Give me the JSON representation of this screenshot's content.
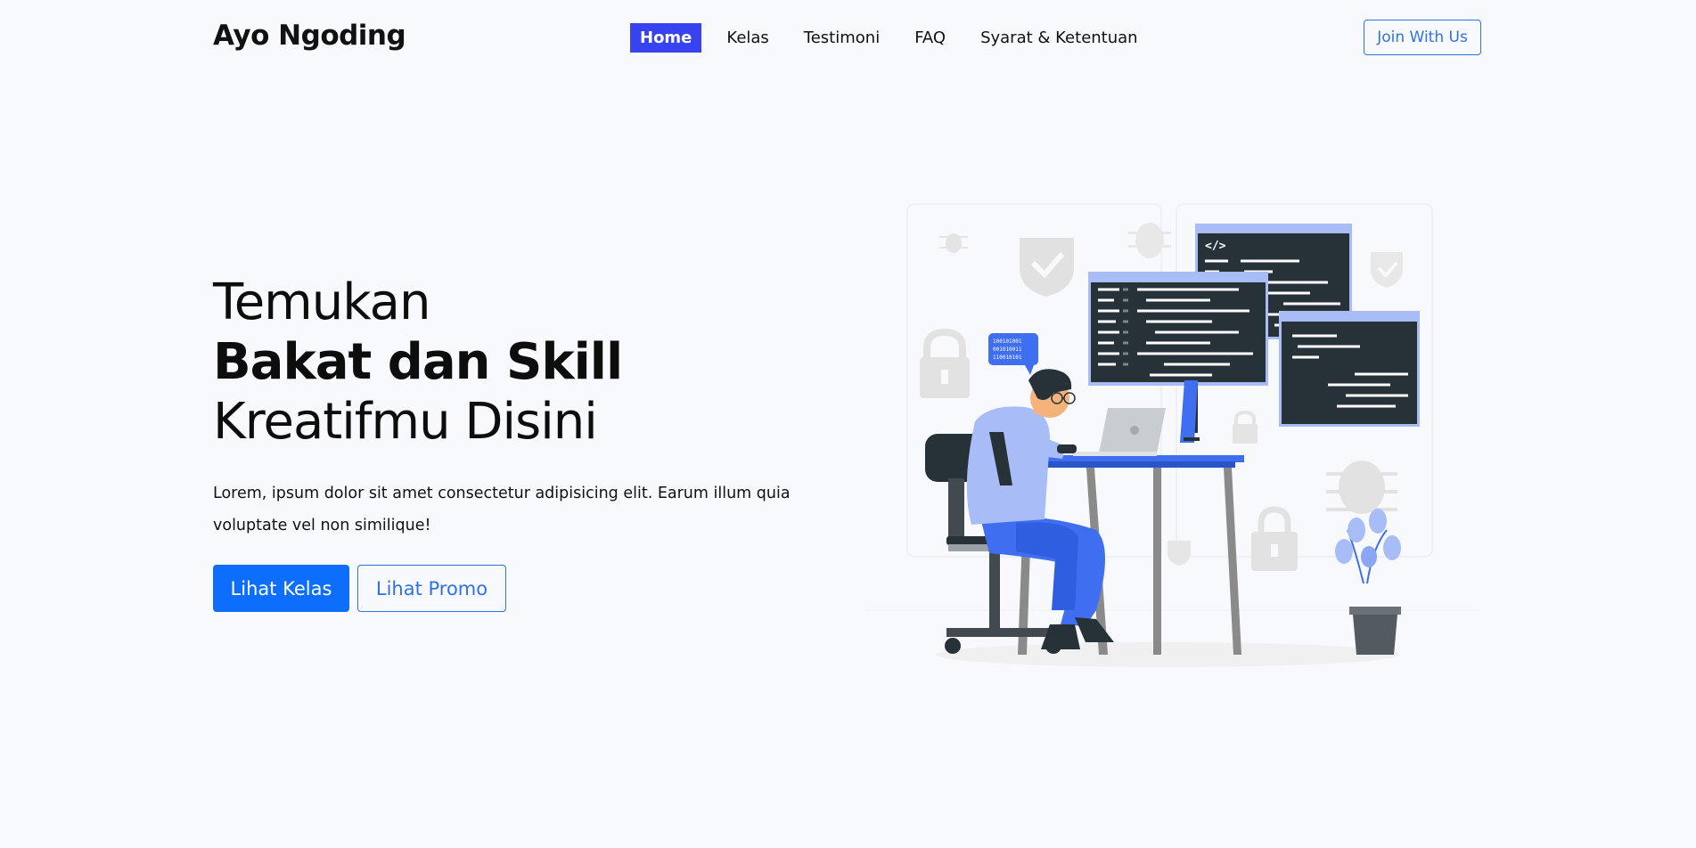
{
  "navbar": {
    "brand": "Ayo Ngoding",
    "links": [
      {
        "label": "Home",
        "active": true
      },
      {
        "label": "Kelas",
        "active": false
      },
      {
        "label": "Testimoni",
        "active": false
      },
      {
        "label": "FAQ",
        "active": false
      },
      {
        "label": "Syarat & Ketentuan",
        "active": false
      }
    ],
    "cta_label": "Join With Us"
  },
  "hero": {
    "title_line1": "Temukan",
    "title_line2": "Bakat dan Skill",
    "title_line3": "Kreatifmu Disini",
    "description": "Lorem, ipsum dolor sit amet consectetur adipisicing elit. Earum illum quia voluptate vel non similique!",
    "primary_button": "Lihat Kelas",
    "secondary_button": "Lihat Promo"
  },
  "illustration": {
    "code_tag": "</>",
    "binary_lines": [
      "100101001",
      "001010011",
      "110010101"
    ]
  },
  "colors": {
    "background": "#f7f9fc",
    "nav_active": "#3743f0",
    "accent": "#0d6efd",
    "outline": "#2f72e6",
    "illustration_blue": "#3f6ff0",
    "illustration_light_blue": "#a8bdf8",
    "screen_dark": "#263238"
  }
}
